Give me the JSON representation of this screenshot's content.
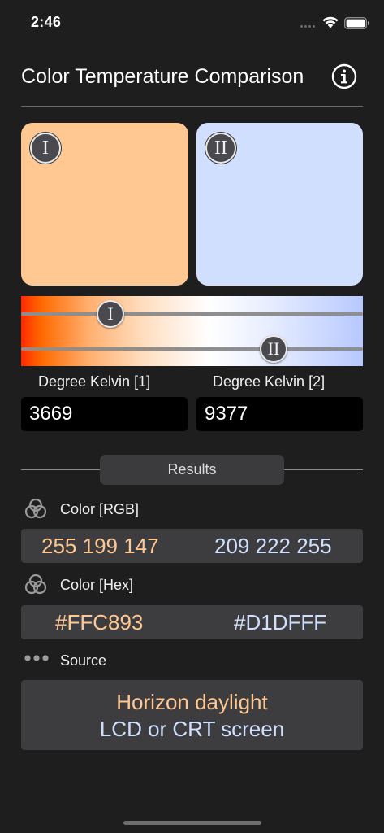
{
  "status": {
    "time": "2:46"
  },
  "nav": {
    "title": "Color Temperature Comparison",
    "info_icon": "info-circle-icon"
  },
  "swatches": [
    {
      "badge": "I",
      "color": "#FFC893"
    },
    {
      "badge": "II",
      "color": "#D1DFFF"
    }
  ],
  "sliders": [
    {
      "thumb_label": "I",
      "kelvin": 3669
    },
    {
      "thumb_label": "II",
      "kelvin": 9377
    }
  ],
  "inputs": {
    "label_1": "Degree Kelvin [1]",
    "label_2": "Degree Kelvin [2]",
    "value_1": "3669",
    "value_2": "9377"
  },
  "results": {
    "tab_label": "Results",
    "rgb": {
      "label": "Color [RGB]",
      "value_1": "255 199 147",
      "value_2": "209 222 255",
      "icon": "color-circles-icon"
    },
    "hex": {
      "label": "Color [Hex]",
      "value_1": "#FFC893",
      "value_2": "#D1DFFF",
      "icon": "color-circles-icon"
    },
    "source": {
      "label": "Source",
      "value_1": "Horizon daylight",
      "value_2": "LCD or CRT screen",
      "icon": "ellipsis-icon"
    }
  },
  "colors": {
    "background": "#1E1E1F",
    "warm": "#FFC893",
    "cool": "#D1DFFF",
    "box": "#3D3D3F"
  }
}
